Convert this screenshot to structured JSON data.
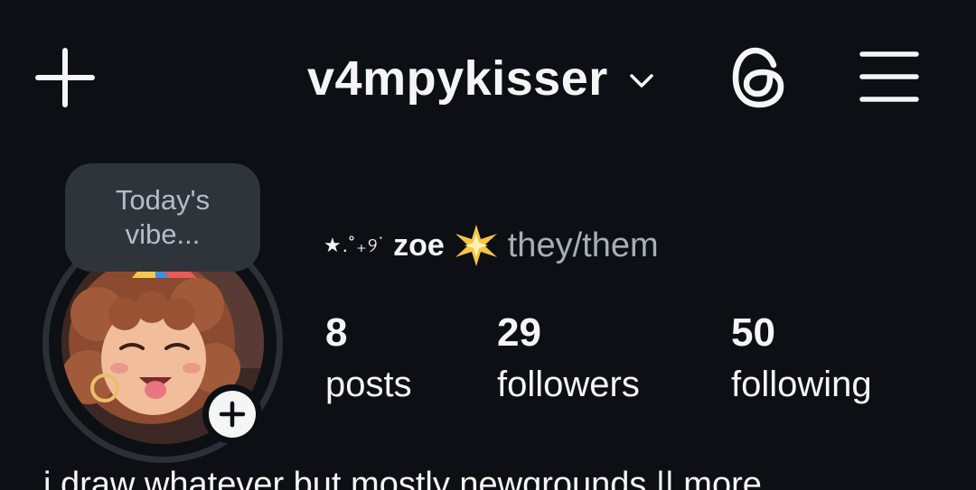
{
  "header": {
    "create_icon": "plus-icon",
    "username": "v4mpykisser",
    "account_switch_icon": "chevron-down-icon",
    "threads_icon": "threads-icon",
    "menu_icon": "hamburger-menu-icon"
  },
  "note": {
    "text_line1": "Today's",
    "text_line2": "vibe..."
  },
  "profile": {
    "name_decoration": "★.˚₊୨˙",
    "display_name": "zoe",
    "name_emoji": "glowing-star-emoji",
    "pronouns": "they/them",
    "add_story_icon": "plus-icon"
  },
  "stats": {
    "posts": {
      "count": "8",
      "label": "posts"
    },
    "followers": {
      "count": "29",
      "label": "followers"
    },
    "following": {
      "count": "50",
      "label": "following"
    }
  },
  "bio": {
    "text": "i draw whatever but mostly newgrounds ||",
    "more": "more"
  },
  "colors": {
    "background": "#0c1014",
    "text": "#f5f5f5",
    "muted": "#a8aeb6",
    "note_bg": "#2f343b"
  }
}
